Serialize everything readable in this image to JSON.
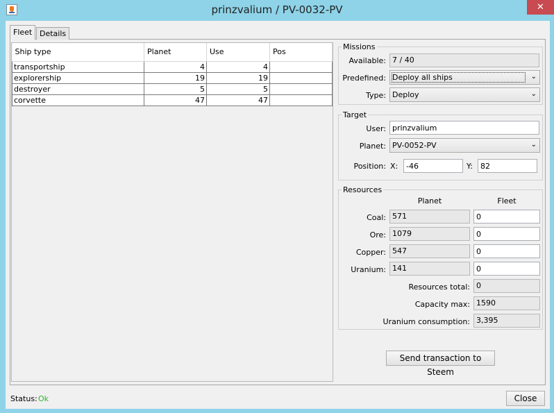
{
  "window": {
    "title": "prinzvalium / PV-0032-PV",
    "close_glyph": "✕"
  },
  "tabs": [
    {
      "label": "Fleet",
      "active": true
    },
    {
      "label": "Details",
      "active": false
    }
  ],
  "fleet_table": {
    "headers": [
      "Ship type",
      "Planet",
      "Use",
      "Pos"
    ],
    "rows": [
      {
        "type": "transportship",
        "planet": "4",
        "use": "4",
        "pos": ""
      },
      {
        "type": "explorership",
        "planet": "19",
        "use": "19",
        "pos": ""
      },
      {
        "type": "destroyer",
        "planet": "5",
        "use": "5",
        "pos": ""
      },
      {
        "type": "corvette",
        "planet": "47",
        "use": "47",
        "pos": ""
      }
    ]
  },
  "missions": {
    "title": "Missions",
    "available_label": "Available:",
    "available_value": "7 / 40",
    "predefined_label": "Predefined:",
    "predefined_value": "Deploy all ships",
    "type_label": "Type:",
    "type_value": "Deploy"
  },
  "target": {
    "title": "Target",
    "user_label": "User:",
    "user_value": "prinzvalium",
    "planet_label": "Planet:",
    "planet_value": "PV-0052-PV",
    "position_label": "Position:",
    "x_label": "X:",
    "x_value": "-46",
    "y_label": "Y:",
    "y_value": "82"
  },
  "resources": {
    "title": "Resources",
    "planet_header": "Planet",
    "fleet_header": "Fleet",
    "rows": [
      {
        "label": "Coal:",
        "planet": "571",
        "fleet": "0"
      },
      {
        "label": "Ore:",
        "planet": "1079",
        "fleet": "0"
      },
      {
        "label": "Copper:",
        "planet": "547",
        "fleet": "0"
      },
      {
        "label": "Uranium:",
        "planet": "141",
        "fleet": "0"
      }
    ],
    "total_label": "Resources total:",
    "total_value": "0",
    "capacity_label": "Capacity max:",
    "capacity_value": "1590",
    "consumption_label": "Uranium consumption:",
    "consumption_value": "3,395"
  },
  "send_button": "Send transaction to Steem",
  "status": {
    "label": "Status:",
    "value": "Ok",
    "color": "#2bb52b"
  },
  "close_button": "Close",
  "dropdown_glyph": "⌄"
}
